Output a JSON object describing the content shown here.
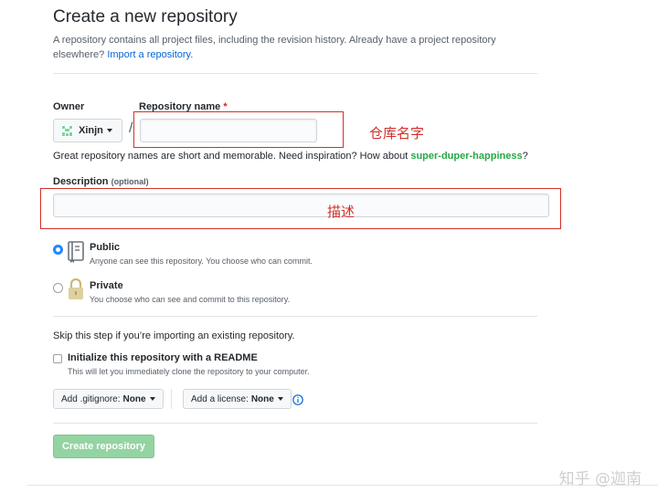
{
  "header": {
    "title": "Create a new repository",
    "subtitle_text": "A repository contains all project files, including the revision history. Already have a project repository elsewhere?",
    "import_link": "Import a repository."
  },
  "owner": {
    "label": "Owner",
    "value": "Xinjn"
  },
  "repo_name": {
    "label": "Repository name",
    "required_mark": "*",
    "value": "",
    "separator": "/",
    "annotation": "仓库名字"
  },
  "hint": {
    "prefix": "Great repository names are short and memorable. Need inspiration? How about",
    "suggestion": "super-duper-happiness",
    "suffix": "?"
  },
  "description": {
    "label": "Description",
    "optional": "(optional)",
    "value": "",
    "annotation": "描述"
  },
  "visibility": {
    "selected": "public",
    "public": {
      "title": "Public",
      "desc": "Anyone can see this repository. You choose who can commit."
    },
    "private": {
      "title": "Private",
      "desc": "You choose who can see and commit to this repository."
    }
  },
  "skip_text": "Skip this step if you’re importing an existing repository.",
  "readme": {
    "checked": false,
    "title": "Initialize this repository with a README",
    "desc": "This will let you immediately clone the repository to your computer."
  },
  "gitignore": {
    "label": "Add .gitignore:",
    "value": "None"
  },
  "license": {
    "label": "Add a license:",
    "value": "None"
  },
  "create_button": "Create repository",
  "watermark": "知乎 @迦南",
  "colors": {
    "annotation_red": "#d0302a",
    "link_blue": "#0366d6",
    "suggestion_green": "#28a745",
    "create_green_disabled": "#94d3a2"
  }
}
